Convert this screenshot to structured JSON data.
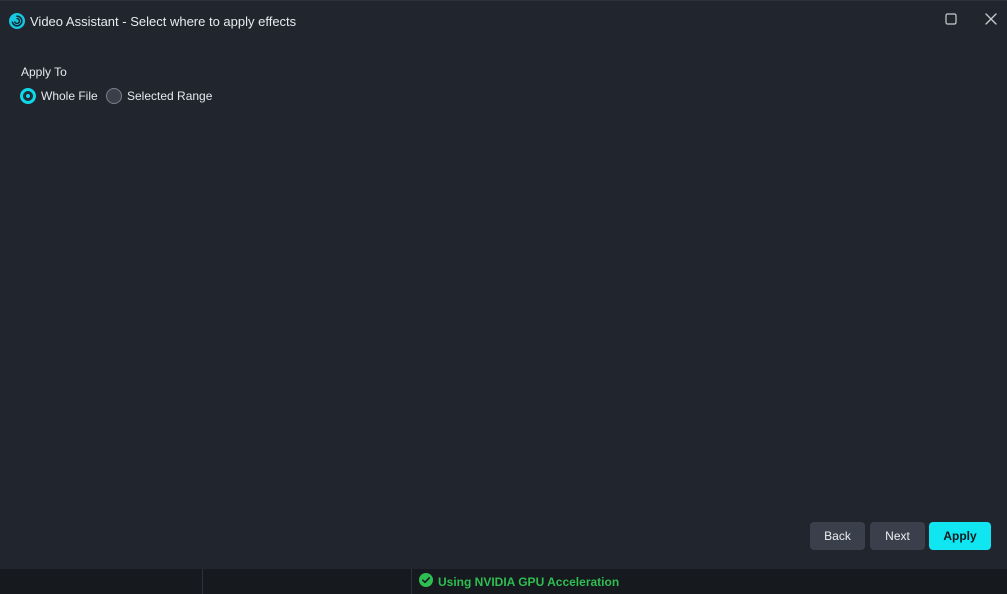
{
  "window": {
    "title": "Video Assistant - Select where to apply effects",
    "app_icon": "swirl-logo-icon",
    "controls": {
      "maximize_icon": "maximize-icon",
      "close_icon": "close-icon"
    }
  },
  "apply_to": {
    "label": "Apply To",
    "options": [
      {
        "label": "Whole File",
        "checked": true
      },
      {
        "label": "Selected Range",
        "checked": false
      }
    ]
  },
  "buttons": {
    "back": "Back",
    "next": "Next",
    "apply": "Apply"
  },
  "status": {
    "icon": "check-circle-icon",
    "text": "Using NVIDIA GPU Acceleration"
  },
  "colors": {
    "accent": "#10e6f2",
    "window_bg": "#21252e",
    "status_ok": "#2fbe52"
  }
}
